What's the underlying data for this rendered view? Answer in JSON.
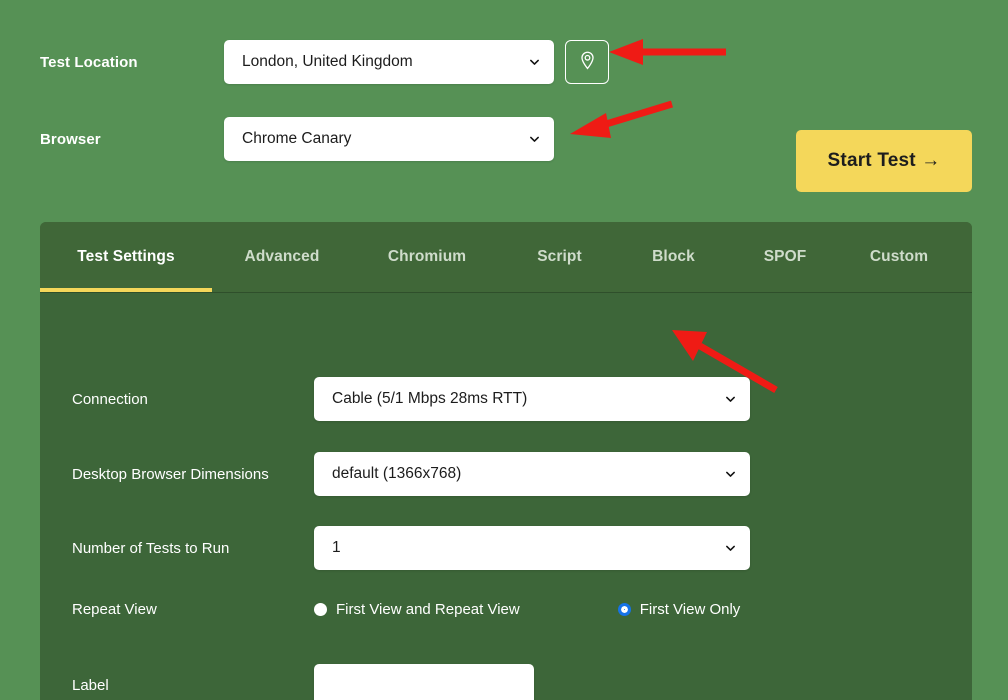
{
  "form": {
    "location": {
      "label": "Test Location",
      "value": "London, United Kingdom",
      "geo_icon": "map-pin-icon"
    },
    "browser": {
      "label": "Browser",
      "value": "Chrome Canary"
    },
    "start_button": "Start Test →"
  },
  "tabs": [
    {
      "label": "Test Settings",
      "active": true
    },
    {
      "label": "Advanced",
      "active": false
    },
    {
      "label": "Chromium",
      "active": false
    },
    {
      "label": "Script",
      "active": false
    },
    {
      "label": "Block",
      "active": false
    },
    {
      "label": "SPOF",
      "active": false
    },
    {
      "label": "Custom",
      "active": false
    }
  ],
  "settings": {
    "connection": {
      "label": "Connection",
      "value": "Cable (5/1 Mbps 28ms RTT)"
    },
    "dimensions": {
      "label": "Desktop Browser Dimensions",
      "value": "default (1366x768)"
    },
    "num_tests": {
      "label": "Number of Tests to Run",
      "value": "1"
    },
    "repeat_view": {
      "label": "Repeat View",
      "option_both": "First View and Repeat View",
      "option_first": "First View Only",
      "selected": "First View Only"
    },
    "label_field": {
      "label": "Label",
      "value": "",
      "placeholder": ""
    }
  },
  "annotations": {
    "arrow_color": "#ef1b15",
    "arrows": [
      {
        "name": "arrow-to-geolocation-button",
        "target": "geolocation-button"
      },
      {
        "name": "arrow-to-browser-select",
        "target": "browser-select"
      },
      {
        "name": "arrow-to-connection-select",
        "target": "connection-select"
      }
    ]
  },
  "colors": {
    "page_bg": "#569155",
    "panel_bg": "#3d6639",
    "tabbar_bg": "#406738",
    "accent_yellow": "#f4d75a",
    "radio_blue": "#1673e8"
  }
}
